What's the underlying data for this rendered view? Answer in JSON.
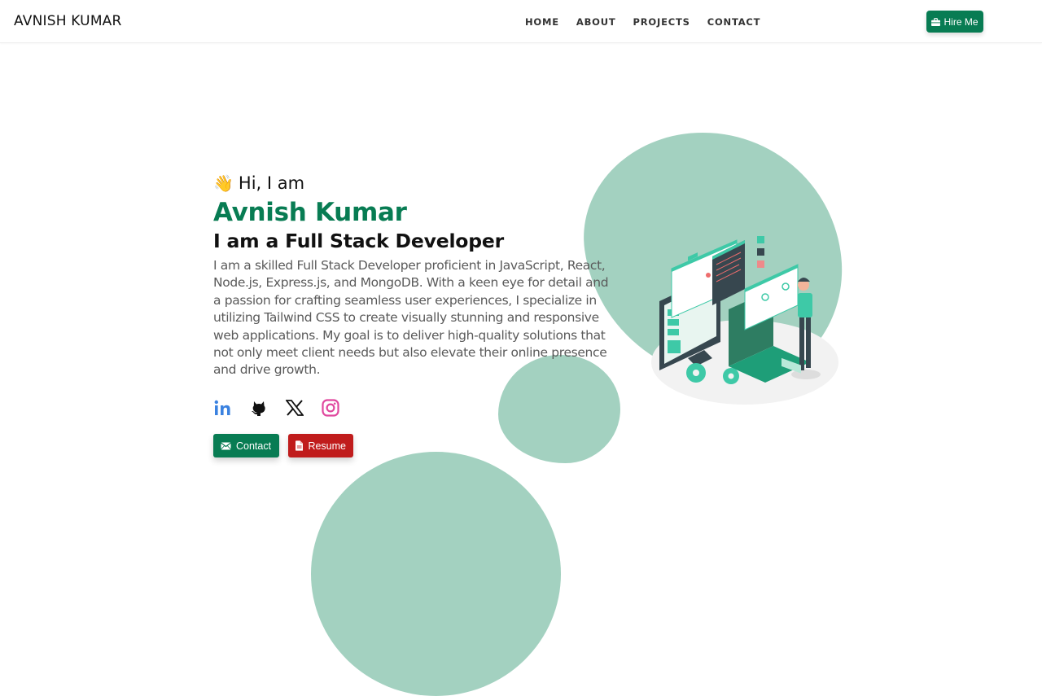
{
  "navbar": {
    "brand": "AVNISH KUMAR",
    "links": [
      "HOME",
      "ABOUT",
      "PROJECTS",
      "CONTACT"
    ],
    "hire_button": {
      "label": "Hire Me",
      "icon": "briefcase-icon"
    }
  },
  "hero": {
    "greeting_icon": "👋",
    "greeting": "Hi, I am",
    "name": "Avnish Kumar",
    "role": "I am a Full Stack Developer",
    "bio": "I am a skilled Full Stack Developer proficient in JavaScript, React, Node.js, Express.js, and MongoDB. With a keen eye for detail and a passion for crafting seamless user experiences, I specialize in utilizing Tailwind CSS to create visually stunning and responsive web applications. My goal is to deliver high-quality solutions that not only meet client needs but also elevate their online presence and drive growth."
  },
  "socials": [
    {
      "name": "LinkedIn",
      "icon": "linkedin-icon"
    },
    {
      "name": "GitHub",
      "icon": "github-icon"
    },
    {
      "name": "X",
      "icon": "x-icon"
    },
    {
      "name": "Instagram",
      "icon": "instagram-icon"
    }
  ],
  "actions": {
    "contact": {
      "label": "Contact",
      "icon": "mail-icon"
    },
    "resume": {
      "label": "Resume",
      "icon": "document-icon"
    }
  },
  "colors": {
    "accent": "#087c53",
    "danger": "#c01c1c",
    "blob": "#a3d1c0",
    "linkedin": "#3b82e0",
    "instagram": "#e0479e"
  },
  "illustration": {
    "alt": "Developer working with multiple screens illustration"
  }
}
